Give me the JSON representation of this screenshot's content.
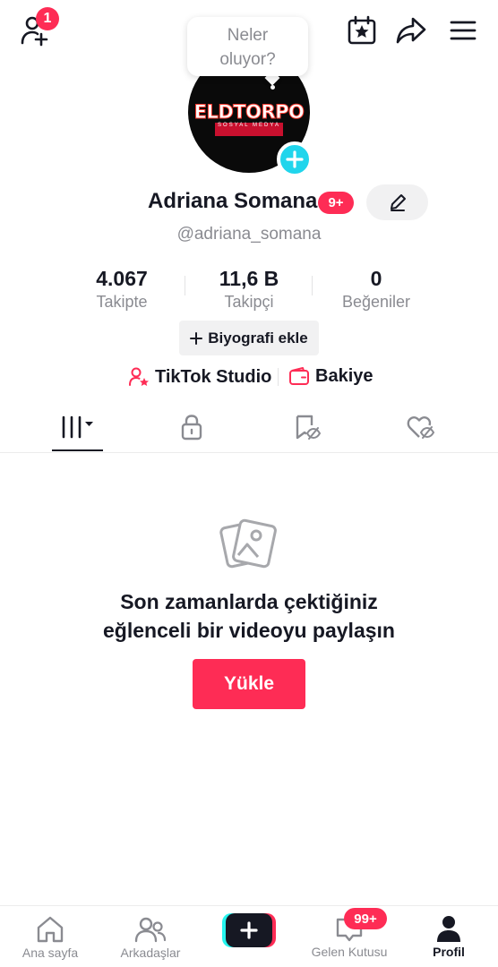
{
  "header": {
    "friends_badge": "1",
    "tooltip": {
      "line1": "Neler",
      "line2": "oluyor?"
    }
  },
  "avatar": {
    "logo_text": "ELDTORPO",
    "logo_sub": "SOSYAL MEDYA"
  },
  "profile": {
    "name": "Adriana Somana",
    "name_badge": "9+",
    "handle": "@adriana_somana"
  },
  "stats": [
    {
      "value": "4.067",
      "label": "Takipte"
    },
    {
      "value": "11,6 B",
      "label": "Takipçi"
    },
    {
      "value": "0",
      "label": "Beğeniler"
    }
  ],
  "bio_button": {
    "label": "Biyografi ekle"
  },
  "links": {
    "studio": "TikTok Studio",
    "balance": "Bakiye"
  },
  "tabs": [
    {
      "icon": "grid-icon",
      "active": true
    },
    {
      "icon": "lock-icon",
      "active": false
    },
    {
      "icon": "bookmark-hidden-icon",
      "active": false
    },
    {
      "icon": "heart-hidden-icon",
      "active": false
    }
  ],
  "empty_state": {
    "line1": "Son zamanlarda çektiğiniz",
    "line2": "eğlenceli bir videoyu paylaşın",
    "button": "Yükle"
  },
  "bottom_nav": {
    "items": [
      {
        "label": "Ana sayfa",
        "icon": "home-icon"
      },
      {
        "label": "Arkadaşlar",
        "icon": "friends-icon"
      },
      {
        "label": "",
        "icon": "create-icon"
      },
      {
        "label": "Gelen Kutusu",
        "icon": "inbox-icon",
        "badge": "99+"
      },
      {
        "label": "Profil",
        "icon": "profile-icon"
      }
    ]
  },
  "colors": {
    "accent": "#fe2c55",
    "cyan": "#25f4ee",
    "text": "#161823",
    "muted": "#8a8b91"
  }
}
